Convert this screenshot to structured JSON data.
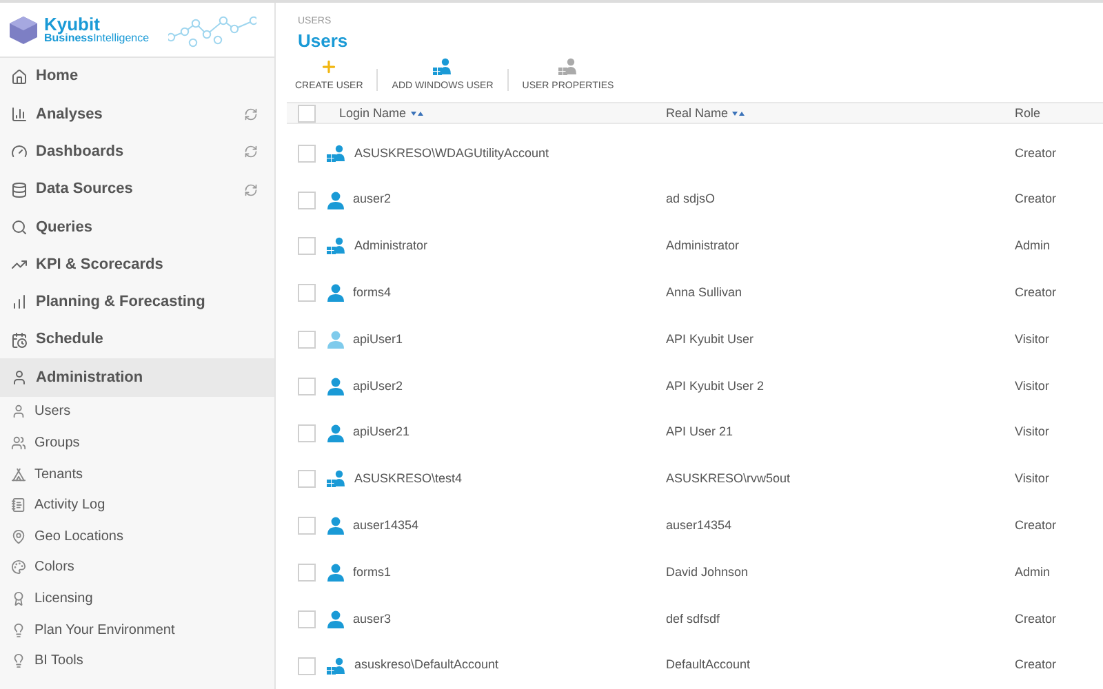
{
  "logo": {
    "name": "Kyubit",
    "tagline_bold": "Business",
    "tagline": "Intelligence"
  },
  "sidebar": {
    "items": [
      {
        "label": "Home",
        "refresh": false,
        "selected": false
      },
      {
        "label": "Analyses",
        "refresh": true,
        "selected": false
      },
      {
        "label": "Dashboards",
        "refresh": true,
        "selected": false
      },
      {
        "label": "Data Sources",
        "refresh": true,
        "selected": false
      },
      {
        "label": "Queries",
        "refresh": false,
        "selected": false
      },
      {
        "label": "KPI & Scorecards",
        "refresh": false,
        "selected": false
      },
      {
        "label": "Planning & Forecasting",
        "refresh": false,
        "selected": false
      },
      {
        "label": "Schedule",
        "refresh": false,
        "selected": false
      },
      {
        "label": "Administration",
        "refresh": false,
        "selected": true
      }
    ],
    "subitems": [
      "Users",
      "Groups",
      "Tenants",
      "Activity Log",
      "Geo Locations",
      "Colors",
      "Licensing",
      "Plan Your Environment",
      "BI Tools"
    ]
  },
  "breadcrumb": "USERS",
  "title": "Users",
  "toolbar": [
    "CREATE USER",
    "ADD WINDOWS USER",
    "USER PROPERTIES"
  ],
  "table": {
    "select_all_checked": false,
    "columns": [
      "Login Name",
      "Real Name",
      "Role"
    ],
    "rows": [
      {
        "login": "ASUSKRESO\\WDAGUtilityAccount",
        "real": "",
        "role": "Creator",
        "kind": "windows",
        "active": true,
        "checked": false
      },
      {
        "login": "auser2",
        "real": "ad sdjsO",
        "role": "Creator",
        "kind": "local",
        "active": true,
        "checked": false
      },
      {
        "login": "Administrator",
        "real": "Administrator",
        "role": "Admin",
        "kind": "windows",
        "active": true,
        "checked": false
      },
      {
        "login": "forms4",
        "real": "Anna Sullivan",
        "role": "Creator",
        "kind": "local",
        "active": true,
        "checked": false
      },
      {
        "login": "apiUser1",
        "real": "API Kyubit User",
        "role": "Visitor",
        "kind": "local",
        "active": false,
        "checked": false
      },
      {
        "login": "apiUser2",
        "real": "API Kyubit User 2",
        "role": "Visitor",
        "kind": "local",
        "active": true,
        "checked": false
      },
      {
        "login": "apiUser21",
        "real": "API User 21",
        "role": "Visitor",
        "kind": "local",
        "active": true,
        "checked": false
      },
      {
        "login": "ASUSKRESO\\test4",
        "real": "ASUSKRESO\\rvw5out",
        "role": "Visitor",
        "kind": "windows",
        "active": true,
        "checked": false
      },
      {
        "login": "auser14354",
        "real": "auser14354",
        "role": "Creator",
        "kind": "local",
        "active": true,
        "checked": false
      },
      {
        "login": "forms1",
        "real": "David Johnson",
        "role": "Admin",
        "kind": "local",
        "active": true,
        "checked": false
      },
      {
        "login": "auser3",
        "real": "def sdfsdf",
        "role": "Creator",
        "kind": "local",
        "active": true,
        "checked": false
      },
      {
        "login": "asuskreso\\DefaultAccount",
        "real": "DefaultAccount",
        "role": "Creator",
        "kind": "windows",
        "active": true,
        "checked": false
      }
    ]
  }
}
